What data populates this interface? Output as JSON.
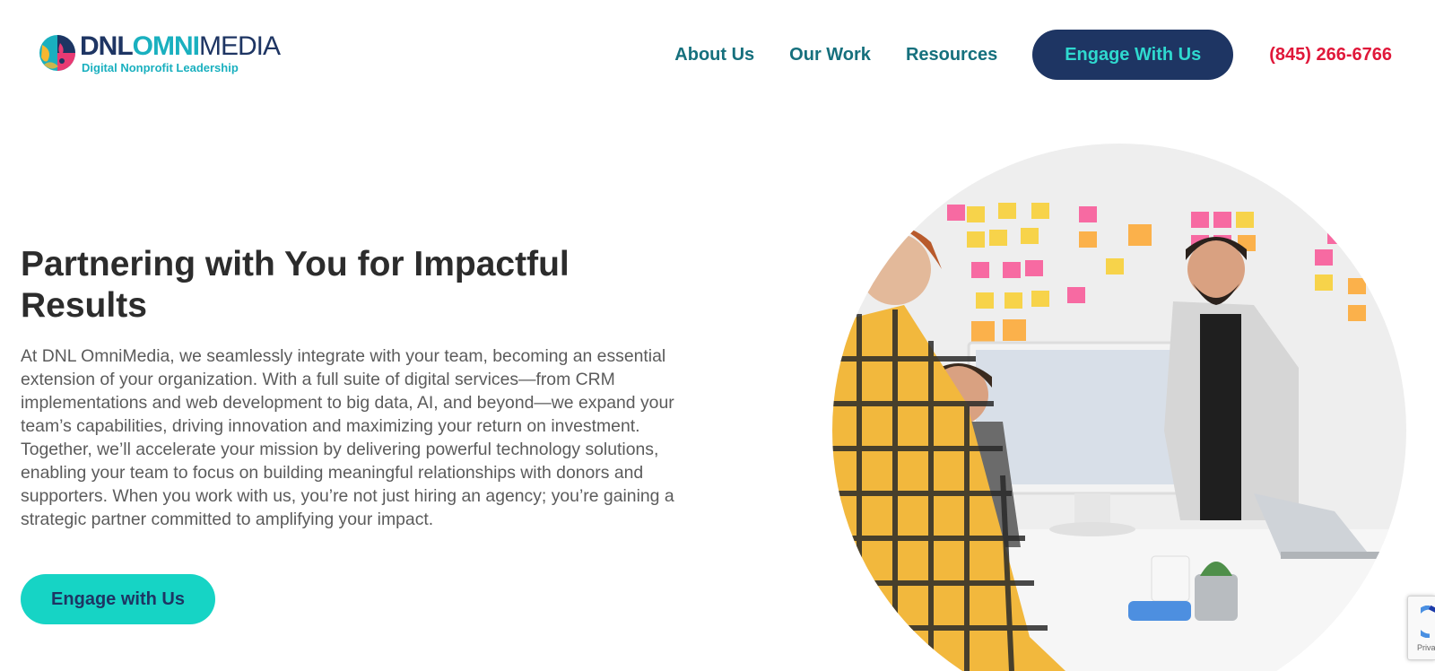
{
  "header": {
    "logo": {
      "word_part1": "DNL",
      "word_part2": "OMNI",
      "word_part3": "MEDIA",
      "tagline": "Digital Nonprofit Leadership"
    },
    "nav": [
      {
        "label": "About Us"
      },
      {
        "label": "Our Work"
      },
      {
        "label": "Resources"
      }
    ],
    "cta_label": "Engage With Us",
    "phone": "(845) 266-6766"
  },
  "hero": {
    "title": "Partnering with You for Impactful Results",
    "body": "At DNL OmniMedia, we seamlessly integrate with your team, becoming an essential extension of your organization. With a full suite of digital services—from CRM implementations and web development to big data, AI, and beyond—we expand your team’s capabilities, driving innovation and maximizing your return on investment. Together, we’ll accelerate your mission by delivering powerful technology solutions, enabling your team to focus on building meaningful relationships with donors and supporters. When you work with us, you’re not just hiring an agency; you’re gaining a strategic partner committed to amplifying your impact.",
    "button_label": "Engage with Us",
    "image_icon": "team-meeting-photo"
  },
  "recaptcha": {
    "icon": "recaptcha-icon",
    "text": "Priva"
  },
  "colors": {
    "navy": "#1e3563",
    "teal": "#1ab0bf",
    "nav_link": "#16707d",
    "cta_text": "#2fd9cf",
    "phone": "#e0183a",
    "hero_button": "#16d4c5"
  }
}
